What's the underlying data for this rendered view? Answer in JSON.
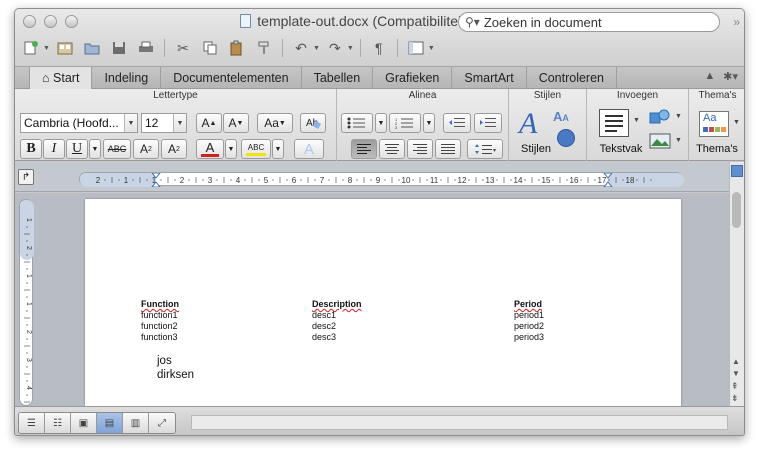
{
  "window": {
    "title": "template-out.docx (Compatibiliteitsmodus)"
  },
  "toolbar": {
    "pilcrow": "¶",
    "search_placeholder": "Zoeken in document"
  },
  "ribbon_tabs": [
    {
      "label": "Start",
      "active": true
    },
    {
      "label": "Indeling",
      "active": false
    },
    {
      "label": "Documentelementen",
      "active": false
    },
    {
      "label": "Tabellen",
      "active": false
    },
    {
      "label": "Grafieken",
      "active": false
    },
    {
      "label": "SmartArt",
      "active": false
    },
    {
      "label": "Controleren",
      "active": false
    }
  ],
  "ribbon": {
    "groups": {
      "font": "Lettertype",
      "paragraph": "Alinea",
      "styles": "Stijlen",
      "insert": "Invoegen",
      "themes": "Thema's"
    },
    "font_name": "Cambria (Hoofd...",
    "font_size": "12",
    "bold": "B",
    "italic": "I",
    "underline": "U",
    "strike": "ABC",
    "superscript": "A",
    "subscript": "A",
    "grow_font": "A",
    "shrink_font": "A",
    "change_case": "Aa",
    "font_color": "A",
    "highlight": "ABC",
    "text_effects": "A",
    "styles_label": "Stijlen",
    "styles_glyph": "A",
    "textbox_label": "Tekstvak",
    "themes_label": "Thema's",
    "themes_glyph": "Aa"
  },
  "ruler": {
    "labels": [
      "2",
      "1",
      "1",
      "2",
      "3",
      "4",
      "5",
      "6",
      "7",
      "8",
      "9",
      "10",
      "11",
      "12",
      "13",
      "14",
      "15",
      "16",
      "17",
      "18"
    ]
  },
  "vruler": {
    "labels": [
      "1",
      "2",
      "1",
      "1",
      "2",
      "3",
      "4"
    ]
  },
  "document": {
    "columns": [
      {
        "header": "Function",
        "rows": [
          "function1",
          "function2",
          "function3"
        ]
      },
      {
        "header": "Description",
        "rows": [
          "desc1",
          "desc2",
          "desc3"
        ]
      },
      {
        "header": "Period",
        "rows": [
          "period1",
          "period2",
          "period3"
        ]
      }
    ],
    "signature": [
      "jos",
      "dirksen"
    ]
  },
  "colors": {
    "accent": "#7fa4d8",
    "font_color_bar": "#d42020",
    "highlight_bar": "#f2e600"
  }
}
